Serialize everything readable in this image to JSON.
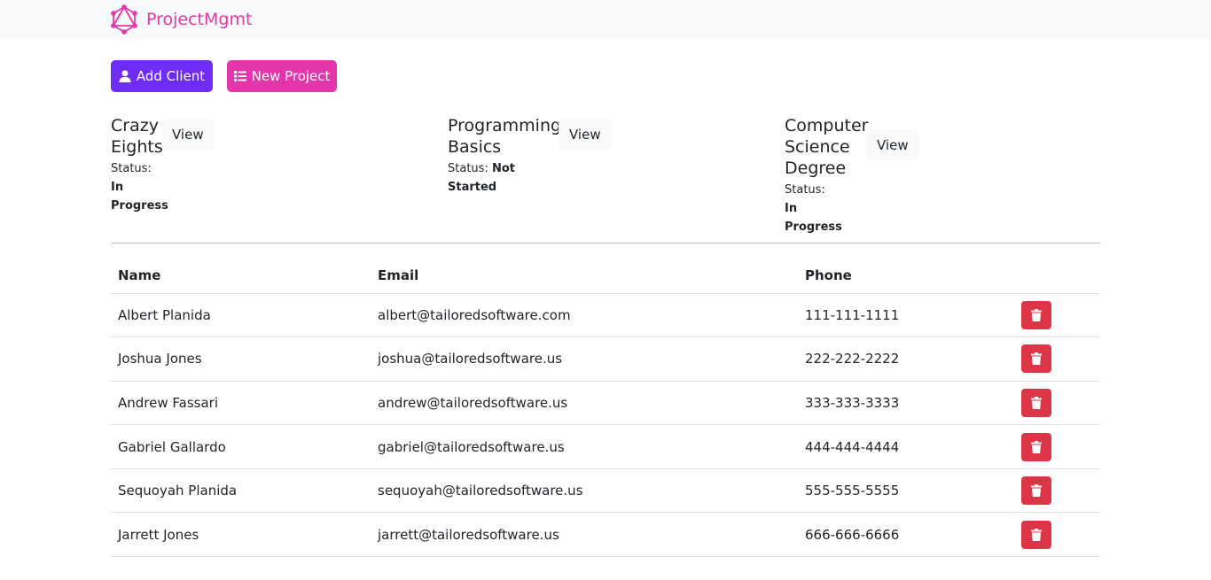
{
  "brand": {
    "name": "ProjectMgmt",
    "color": "#e535ab"
  },
  "actions": {
    "add_client": "Add Client",
    "new_project": "New Project"
  },
  "colors": {
    "add_client_bg": "#6f2cf4",
    "new_project_bg": "#e535ab",
    "delete_bg": "#dc3545"
  },
  "projects": [
    {
      "name": "Crazy Eights",
      "status_label": "Status:",
      "status": "In Progress",
      "view": "View"
    },
    {
      "name": "Programming Basics",
      "status_label": "Status:",
      "status": "Not Started",
      "view": "View"
    },
    {
      "name": "Computer Science Degree",
      "status_label": "Status:",
      "status": "In Progress",
      "view": "View"
    }
  ],
  "clients_table": {
    "headers": {
      "name": "Name",
      "email": "Email",
      "phone": "Phone"
    },
    "rows": [
      {
        "name": "Albert Planida",
        "email": "albert@tailoredsoftware.com",
        "phone": "111-111-1111"
      },
      {
        "name": "Joshua Jones",
        "email": "joshua@tailoredsoftware.us",
        "phone": "222-222-2222"
      },
      {
        "name": "Andrew Fassari",
        "email": "andrew@tailoredsoftware.us",
        "phone": "333-333-3333"
      },
      {
        "name": "Gabriel Gallardo",
        "email": "gabriel@tailoredsoftware.us",
        "phone": "444-444-4444"
      },
      {
        "name": "Sequoyah Planida",
        "email": "sequoyah@tailoredsoftware.us",
        "phone": "555-555-5555"
      },
      {
        "name": "Jarrett Jones",
        "email": "jarrett@tailoredsoftware.us",
        "phone": "666-666-6666"
      }
    ],
    "row_action_icon": "trash-icon"
  }
}
